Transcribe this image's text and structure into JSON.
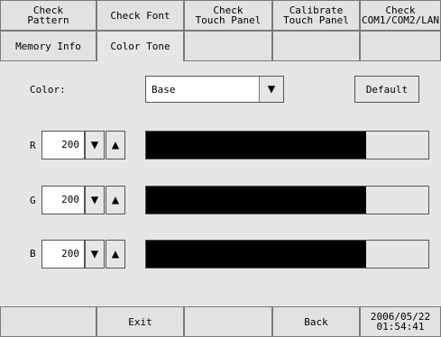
{
  "tabs_row1": [
    "Check\nPattern",
    "Check Font",
    "Check\nTouch Panel",
    "Calibrate\nTouch Panel",
    "Check\nCOM1/COM2/LAN"
  ],
  "tabs_row2": [
    "Memory Info",
    "Color Tone",
    "",
    "",
    ""
  ],
  "color": {
    "label": "Color:",
    "selected": "Base",
    "arrow": "▼",
    "default_label": "Default"
  },
  "channels": [
    {
      "name": "R",
      "value": "200",
      "level": 0.78
    },
    {
      "name": "G",
      "value": "200",
      "level": 0.78
    },
    {
      "name": "B",
      "value": "200",
      "level": 0.78
    }
  ],
  "stepper": {
    "down": "▼",
    "up": "▲"
  },
  "footer": {
    "cells": [
      "",
      "Exit",
      "",
      "Back"
    ],
    "date": "2006/05/22",
    "time": "01:54:41"
  }
}
